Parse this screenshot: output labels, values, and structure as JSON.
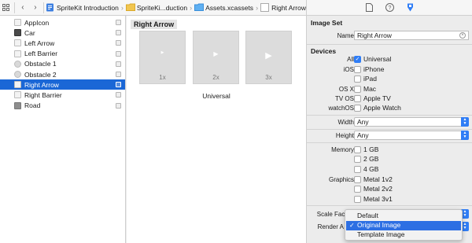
{
  "jumpbar": {
    "crumbs": [
      "SpriteKit Introduction",
      "SpriteKi...duction",
      "Assets.xcassets",
      "Right Arrow"
    ]
  },
  "asset_list": {
    "items": [
      {
        "label": "AppIcon",
        "thumb": "app-icon"
      },
      {
        "label": "Car",
        "thumb": "dark"
      },
      {
        "label": "Left Arrow",
        "thumb": "plain"
      },
      {
        "label": "Left Barrier",
        "thumb": "plain"
      },
      {
        "label": "Obstacle 1",
        "thumb": "round"
      },
      {
        "label": "Obstacle 2",
        "thumb": "round"
      },
      {
        "label": "Right Arrow",
        "thumb": "plain",
        "selected": true
      },
      {
        "label": "Right Barrier",
        "thumb": "plain"
      },
      {
        "label": "Road",
        "thumb": "gray"
      }
    ]
  },
  "canvas": {
    "set_name": "Right Arrow",
    "slots": [
      "1x",
      "2x",
      "3x"
    ],
    "device_label": "Universal"
  },
  "inspector": {
    "image_set_title": "Image Set",
    "name_label": "Name",
    "name_value": "Right Arrow",
    "devices_title": "Devices",
    "devices": [
      {
        "group": "All",
        "option": "Universal",
        "checked": true
      },
      {
        "group": "iOS",
        "option": "iPhone",
        "checked": false
      },
      {
        "group": "",
        "option": "iPad",
        "checked": false
      },
      {
        "group": "OS X",
        "option": "Mac",
        "checked": false
      },
      {
        "group": "TV OS",
        "option": "Apple TV",
        "checked": false
      },
      {
        "group": "watchOS",
        "option": "Apple Watch",
        "checked": false
      }
    ],
    "width_label": "Width",
    "width_value": "Any",
    "height_label": "Height",
    "height_value": "Any",
    "memory_label": "Memory",
    "memory_options": [
      "1 GB",
      "2 GB",
      "4 GB"
    ],
    "graphics_label": "Graphics",
    "graphics_options": [
      "Metal 1v2",
      "Metal 2v2",
      "Metal 3v1"
    ],
    "scale_label": "Scale Facto",
    "render_label": "Render A"
  },
  "render_menu": {
    "items": [
      "Default",
      "Original Image",
      "Template Image"
    ],
    "selected": "Original Image"
  },
  "colors": {
    "selection": "#1a67d6",
    "accent": "#2f7df6"
  }
}
